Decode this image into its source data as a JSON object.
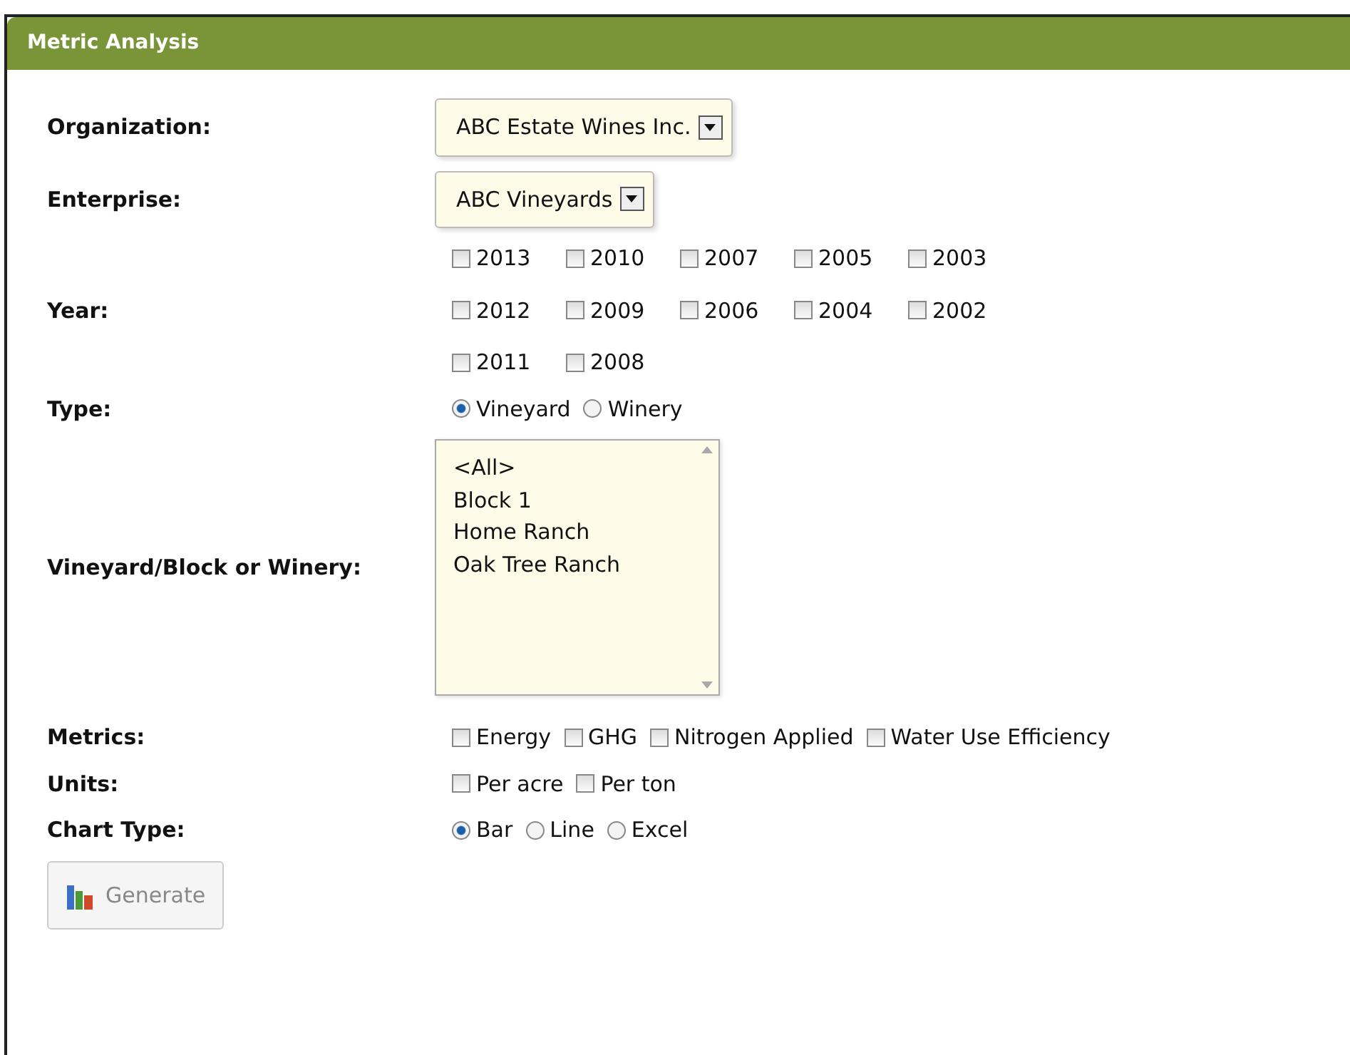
{
  "panel": {
    "title": "Metric Analysis"
  },
  "fields": [
    {
      "kind": "select",
      "label": "Organization:",
      "value": "ABC Estate Wines Inc."
    },
    {
      "kind": "select",
      "label": "Enterprise:",
      "value": "ABC Vineyards"
    },
    {
      "kind": "checkgrid",
      "label": "Year:",
      "options": [
        {
          "label": "2013",
          "checked": false
        },
        {
          "label": "2010",
          "checked": false
        },
        {
          "label": "2007",
          "checked": false
        },
        {
          "label": "2005",
          "checked": false
        },
        {
          "label": "2003",
          "checked": false
        },
        {
          "label": "2012",
          "checked": false
        },
        {
          "label": "2009",
          "checked": false
        },
        {
          "label": "2006",
          "checked": false
        },
        {
          "label": "2004",
          "checked": false
        },
        {
          "label": "2002",
          "checked": false
        },
        {
          "label": "2011",
          "checked": false
        },
        {
          "label": "2008",
          "checked": false
        }
      ]
    },
    {
      "kind": "radio",
      "label": "Type:",
      "options": [
        {
          "label": "Vineyard",
          "selected": true
        },
        {
          "label": "Winery",
          "selected": false
        }
      ]
    },
    {
      "kind": "listbox",
      "label": "Vineyard/Block or Winery:",
      "items": [
        {
          "label": "<All>",
          "selected": false
        },
        {
          "label": "Block 1",
          "selected": false
        },
        {
          "label": "Home Ranch",
          "selected": false
        },
        {
          "label": "Oak Tree Ranch",
          "selected": false
        }
      ]
    },
    {
      "kind": "checks",
      "label": "Metrics:",
      "options": [
        {
          "label": "Energy",
          "checked": false
        },
        {
          "label": "GHG",
          "checked": false
        },
        {
          "label": "Nitrogen Applied",
          "checked": false
        },
        {
          "label": "Water Use Efficiency",
          "checked": false
        }
      ]
    },
    {
      "kind": "checks",
      "label": "Units:",
      "options": [
        {
          "label": "Per acre",
          "checked": false
        },
        {
          "label": "Per ton",
          "checked": false
        }
      ]
    },
    {
      "kind": "radio",
      "label": "Chart Type:",
      "options": [
        {
          "label": "Bar",
          "selected": true
        },
        {
          "label": "Line",
          "selected": false
        },
        {
          "label": "Excel",
          "selected": false
        }
      ]
    }
  ],
  "generate_button": {
    "label": "Generate",
    "disabled": true
  }
}
